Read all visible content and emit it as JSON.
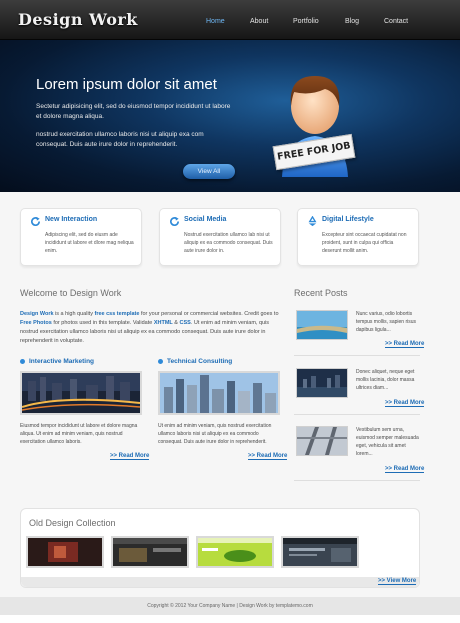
{
  "header": {
    "logo": "Design Work",
    "nav": [
      "Home",
      "About",
      "Portfolio",
      "Blog",
      "Contact"
    ],
    "active_nav": "Home",
    "accent": "#6fb8f5"
  },
  "banner": {
    "title": "Lorem ipsum dolor sit amet",
    "text1": "Sectetur adipisicing elit, sed do eiusmod tempor incididunt ut labore et dolore magna aliqua.",
    "text2": "nostrud exercitation ullamco laboris nisi ut aliquip exa com consequat. Duis aute irure dolor in reprehenderit.",
    "button": "View All",
    "sign": "FREE FOR JOB"
  },
  "features": [
    {
      "title": "New Interaction",
      "icon": "refresh-icon",
      "text": "Adipiscing elit, sed do eiusm ade incididunt ut labore et dlore mag neliqua enim."
    },
    {
      "title": "Social Media",
      "icon": "refresh-icon",
      "text": "Nostrud exercitation ullamco lab nisi ut aliquip ex ea commodo consequat. Duis aute irure dolor in."
    },
    {
      "title": "Digital Lifestyle",
      "icon": "recycle-icon",
      "text": "Excepteur sint occaecat cupidatat non proident, sunt in culpa qui officia deserunt mollit anim."
    }
  ],
  "welcome": {
    "heading": "Welcome to Design Work",
    "intro_brand": "Design Work",
    "intro_a": " is a high quality ",
    "intro_hl1": "free css template",
    "intro_b": " for your personal or commercial websites. Credit goes to ",
    "intro_hl2": "Free Photos",
    "intro_c": " for photos used in this template. Validate ",
    "intro_hl3": "XHTML",
    "intro_d": " & ",
    "intro_hl4": "CSS",
    "intro_e": ". Ut enim ad minim veniam, quis nostrud exercitation ullamco laboris nisi ut aliquip ex ea commodo consequat. Duis aute irure dolor in reprehenderit in voluptate.",
    "col1_title": "Interactive Marketing",
    "col1_text": "Eiusmod tempor incididunt ut labore et dolore magna aliqua. Ut enim ad minim veniam, quis nostrud exercitation ullamco laboris.",
    "col2_title": "Technical Consulting",
    "col2_text": "Ut enim ad minim veniam, quis nostrud exercitation ullamco laboris nisi ut aliquip ex ea commodo consequat. Duis aute irure dolor in reprehenderit.",
    "read_more": ">> Read More"
  },
  "recent": {
    "heading": "Recent Posts",
    "posts": [
      {
        "text": "Nunc varius, odio lobortis tempus mollis, sapien risus dapibus ligula..."
      },
      {
        "text": "Donec aliquet, neque eget mollis lacinia, dolor massa ultrices diam..."
      },
      {
        "text": "Vestibulum sem urna, euismod semper malesuada eget, vehicula sit amet lorem..."
      }
    ],
    "read_more": ">> Read More"
  },
  "collection": {
    "heading": "Old Design Collection",
    "view_more": ">> View More"
  },
  "footer": {
    "text": "Copyright © 2012 Your Company Name | Design Work by templatemo.com"
  }
}
